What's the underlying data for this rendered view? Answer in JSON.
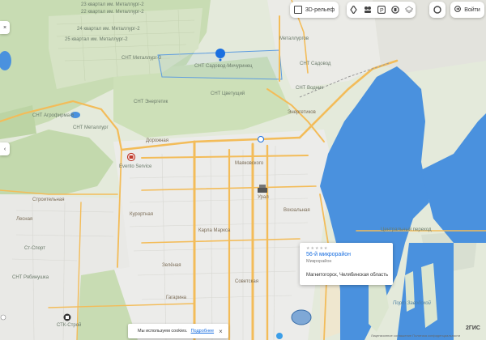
{
  "toolbar": {
    "view3d_label": "3D-рельеф",
    "login_label": "Войти",
    "icons": [
      "traffic-icon",
      "people-icon",
      "parking-icon",
      "transport-icon",
      "layers-icon",
      "clock-icon"
    ]
  },
  "left_controls": {
    "close_icon": "×",
    "back_icon": "‹"
  },
  "place_card": {
    "rating_stars": "★★★★★",
    "title": "56-й микрорайон",
    "subtitle": "Микрорайон",
    "address": "Магнитогорск, Челябинская область"
  },
  "map_labels": {
    "quarter_top1": "23 квартал им. Металлург-2",
    "quarter_top2": "22 квартал им. Металлург-2",
    "quarter_top3": "24 квартал им. Металлург-2",
    "quarter_top4": "25 квартал им. Металлург-2",
    "sad_metallurg": "СНТ Садовод-Мичуринец",
    "district_mid": "СНТ Металлург-3",
    "snt_energetik": "СНТ Энергетик",
    "snt_vodnik": "СНТ Водник",
    "metallurg_sad": "Металлургов",
    "snt_sad": "СНТ Садовод",
    "snt_tsvet": "СНТ Цветущий",
    "snt_left1": "СНТ Агрофирма-6",
    "snt_left2": "СНТ Металлург",
    "dorozhnaya": "Дорожная",
    "energetik_st": "Энергетиков",
    "kurortnaya": "Курортная",
    "service_station": "Evento Service",
    "stroitelnaya": "Строительная",
    "lesnaya": "Лесная",
    "sport_complex": "Ст-Спорт",
    "stk_store": "СТК-Строй",
    "snt_bottom": "СНТ Рябинушка",
    "tsentralniy_proezd": "Центральный переход",
    "port_zavodskoy": "Порт Заводской",
    "ural": "Урал",
    "mayakovskogo": "Маяковского",
    "karla_marksa": "Карла Маркса",
    "zelenaya": "Зелёная",
    "sovetskaya": "Советская",
    "vokzalnaya": "Вокзальная",
    "gagarina": "Гагарина"
  },
  "cookie_banner": {
    "text": "Мы используем cookies.",
    "link": "Подробнее",
    "close": "×"
  },
  "brand": {
    "logo_text": "2ГИС",
    "attribution": "Лицензионное соглашение  Политика конфиденциальности"
  },
  "colors": {
    "road": "#f3bc59",
    "water": "#4a91de",
    "forest": "#c8dcb3",
    "field": "#dfe6d2",
    "urban": "#ececea",
    "accent": "#1a6fe0"
  }
}
